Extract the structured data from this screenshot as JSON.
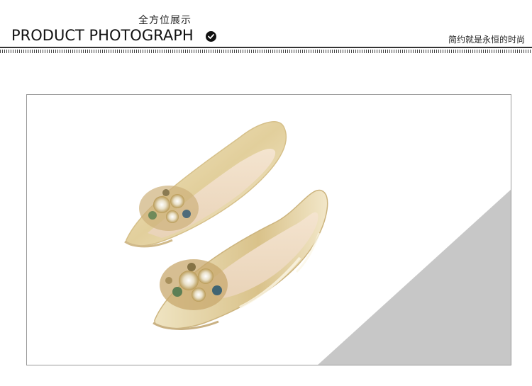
{
  "header": {
    "title_cn": "全方位展示",
    "title_en": "PRODUCT PHOTOGRAPH",
    "badge_icon": "check-circle-icon",
    "slogan": "简约就是永恒的时尚"
  },
  "product": {
    "image_subject": "gold-ballet-flat-shoes-with-crystal-flower-embellishment",
    "accent_color": "#e8d9b0",
    "background_triangle_color": "#c7c7c7"
  }
}
